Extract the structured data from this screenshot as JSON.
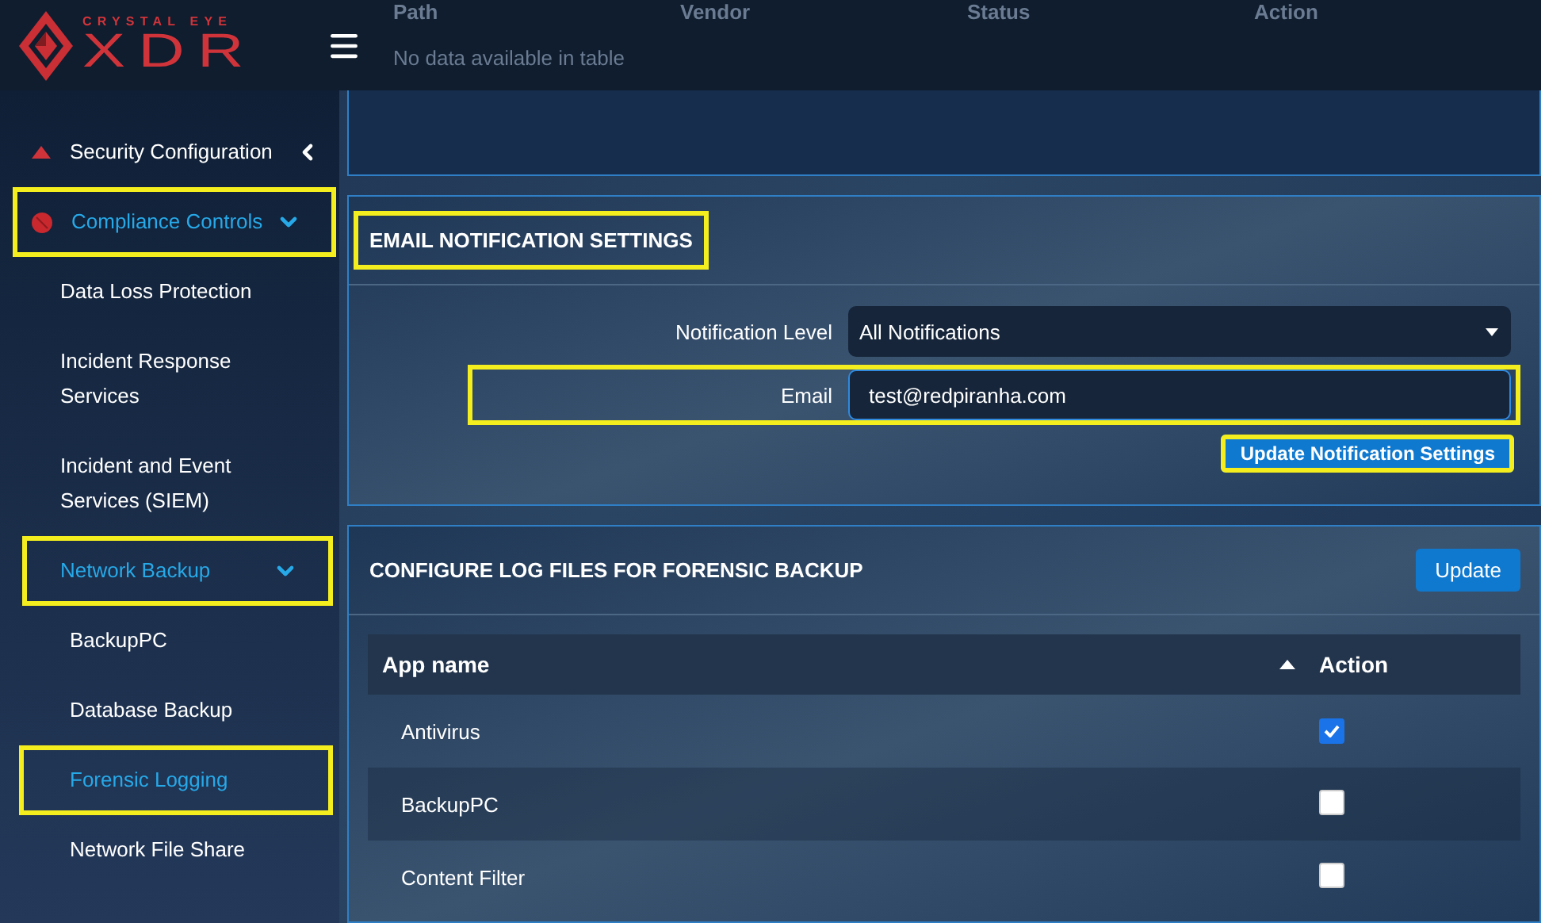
{
  "logo": {
    "tagline": "CRYSTAL EYE",
    "name": "XDR"
  },
  "background_table": {
    "columns": [
      "Path",
      "Vendor",
      "Status",
      "Action"
    ],
    "empty_text": "No data available in table"
  },
  "sidebar": {
    "items": [
      {
        "label": "Security Configuration",
        "expanded": false,
        "selected": false,
        "highlighted": false
      },
      {
        "label": "Compliance Controls",
        "expanded": true,
        "selected": true,
        "highlighted": true,
        "children": [
          {
            "label": "Data Loss Protection",
            "selected": false,
            "highlighted": false
          },
          {
            "label": "Incident Response Services",
            "selected": false,
            "highlighted": false
          },
          {
            "label": "Incident and Event Services (SIEM)",
            "selected": false,
            "highlighted": false
          },
          {
            "label": "Network Backup",
            "expanded": true,
            "selected": true,
            "highlighted": true,
            "children": [
              {
                "label": "BackupPC",
                "selected": false,
                "highlighted": false
              },
              {
                "label": "Database Backup",
                "selected": false,
                "highlighted": false
              },
              {
                "label": "Forensic Logging",
                "selected": true,
                "highlighted": true
              },
              {
                "label": "Network File Share",
                "selected": false,
                "highlighted": false
              }
            ]
          }
        ]
      }
    ]
  },
  "email_panel": {
    "title": "EMAIL NOTIFICATION SETTINGS",
    "title_highlighted": true,
    "fields": [
      {
        "kind": "select",
        "label": "Notification Level",
        "value": "All Notifications",
        "highlighted": false
      },
      {
        "kind": "text",
        "label": "Email",
        "value": "test@redpiranha.com",
        "highlighted": true
      }
    ],
    "button": {
      "label": "Update Notification Settings",
      "highlighted": true
    }
  },
  "log_panel": {
    "title": "CONFIGURE LOG FILES FOR FORENSIC BACKUP",
    "button": "Update",
    "table": {
      "columns": [
        "App name",
        "Action"
      ],
      "rows": [
        {
          "name": "Antivirus",
          "checked": true
        },
        {
          "name": "BackupPC",
          "checked": false
        },
        {
          "name": "Content Filter",
          "checked": false
        }
      ]
    }
  }
}
